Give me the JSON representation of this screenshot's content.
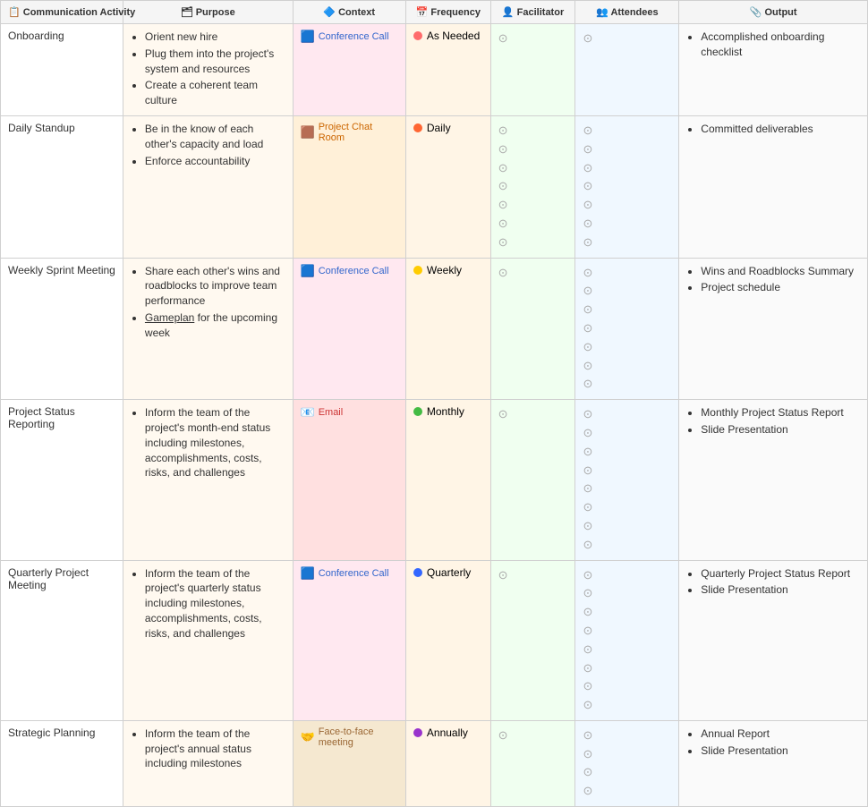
{
  "table": {
    "title": "Communication Activity",
    "columns": [
      {
        "id": "activity",
        "label": "Communication Activity",
        "icon": "📋"
      },
      {
        "id": "purpose",
        "label": "Purpose",
        "icon": "🗂"
      },
      {
        "id": "context",
        "label": "Context",
        "icon": "🔷"
      },
      {
        "id": "frequency",
        "label": "Frequency",
        "icon": "📅"
      },
      {
        "id": "facilitator",
        "label": "Facilitator",
        "icon": "👤"
      },
      {
        "id": "attendees",
        "label": "Attendees",
        "icon": "👥"
      },
      {
        "id": "output",
        "label": "Output",
        "icon": "📎"
      }
    ],
    "rows": [
      {
        "activity": "Onboarding",
        "purpose": [
          "Orient new hire",
          "Plug them into the project's system and resources",
          "Create a coherent team culture"
        ],
        "context_label": "Conference Call",
        "context_icon": "🟦",
        "context_color": "#e8f0fe",
        "context_text_color": "#3366cc",
        "freq_label": "As Needed",
        "freq_color": "#ff6b6b",
        "facilitator_count": 1,
        "attendees_count": 1,
        "output": [
          "Accomplished onboarding checklist"
        ]
      },
      {
        "activity": "Daily Standup",
        "purpose": [
          "Be in the know of each other's capacity and load",
          "Enforce accountability"
        ],
        "context_label": "Project Chat Room",
        "context_icon": "🟫",
        "context_color": "#fff0e0",
        "context_text_color": "#cc6600",
        "freq_label": "Daily",
        "freq_color": "#ff6633",
        "facilitator_count": 7,
        "attendees_count": 7,
        "output": [
          "Committed deliverables"
        ]
      },
      {
        "activity": "Weekly Sprint Meeting",
        "purpose": [
          "Share each other's wins and roadblocks to improve team performance",
          "Gameplan for the upcoming week"
        ],
        "purpose_link_index": 1,
        "purpose_link_text": "Gameplan",
        "context_label": "Conference Call",
        "context_icon": "🟦",
        "context_color": "#e8f0fe",
        "context_text_color": "#3366cc",
        "freq_label": "Weekly",
        "freq_color": "#ffcc00",
        "facilitator_count": 1,
        "attendees_count": 7,
        "output": [
          "Wins and Roadblocks Summary",
          "Project schedule"
        ]
      },
      {
        "activity": "Project Status Reporting",
        "purpose": [
          "Inform the team of the project's month-end status including milestones, accomplishments, costs, risks, and challenges"
        ],
        "context_label": "Email",
        "context_icon": "📧",
        "context_color": "#ffe8e8",
        "context_text_color": "#cc3333",
        "freq_label": "Monthly",
        "freq_color": "#44bb44",
        "facilitator_count": 1,
        "attendees_count": 8,
        "output": [
          "Monthly Project Status Report",
          "Slide Presentation"
        ]
      },
      {
        "activity": "Quarterly Project Meeting",
        "purpose": [
          "Inform the team of the project's quarterly status including milestones, accomplishments, costs, risks, and challenges"
        ],
        "context_label": "Conference Call",
        "context_icon": "🟦",
        "context_color": "#e8f0fe",
        "context_text_color": "#3366cc",
        "freq_label": "Quarterly",
        "freq_color": "#3366ff",
        "facilitator_count": 1,
        "attendees_count": 8,
        "output": [
          "Quarterly Project Status Report",
          "Slide Presentation"
        ]
      },
      {
        "activity": "Strategic Planning",
        "purpose": [
          "Inform the team of the project's annual status including milestones"
        ],
        "context_label": "Face-to-face meeting",
        "context_icon": "🤝",
        "context_color": "#f5e8d0",
        "context_text_color": "#996633",
        "freq_label": "Annually",
        "freq_color": "#9933cc",
        "facilitator_count": 1,
        "attendees_count": 4,
        "output": [
          "Annual Report",
          "Slide Presentation"
        ]
      }
    ]
  }
}
